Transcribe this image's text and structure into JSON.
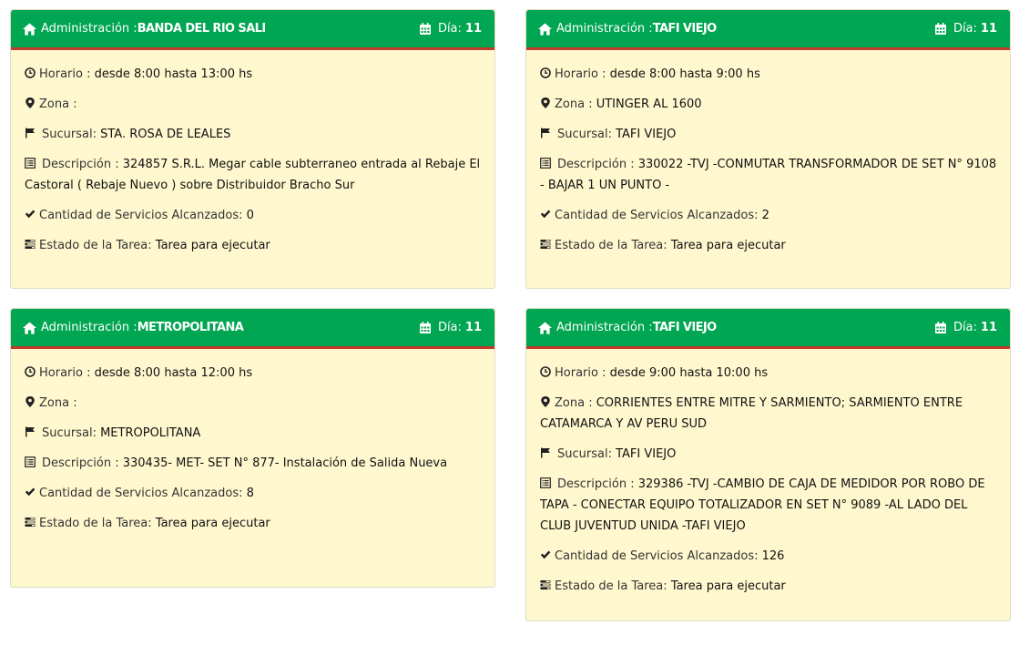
{
  "cards": [
    {
      "admin_label": "Administración :",
      "admin_value": "BANDA DEL RIO SALI",
      "dia_label": "Día:",
      "dia_value": "11",
      "horario_label": "Horario : ",
      "horario_value": "desde 8:00 hasta 13:00 hs",
      "zona_label": "Zona : ",
      "zona_value": "",
      "sucursal_label": "Sucursal: ",
      "sucursal_value": "STA. ROSA DE LEALES",
      "descripcion_label": "Descripción : ",
      "descripcion_value": "324857 S.R.L. Megar cable subterraneo entrada al Rebaje El Castoral ( Rebaje Nuevo ) sobre Distribuidor Bracho Sur",
      "cantidad_label": "Cantidad de Servicios Alcanzados: ",
      "cantidad_value": "0",
      "estado_label": "Estado de la Tarea: ",
      "estado_value": "Tarea para ejecutar"
    },
    {
      "admin_label": "Administración :",
      "admin_value": "TAFI VIEJO",
      "dia_label": "Día:",
      "dia_value": "11",
      "horario_label": "Horario : ",
      "horario_value": "desde 8:00 hasta 9:00 hs",
      "zona_label": "Zona : ",
      "zona_value": "UTINGER AL 1600",
      "sucursal_label": "Sucursal: ",
      "sucursal_value": "TAFI VIEJO",
      "descripcion_label": "Descripción : ",
      "descripcion_value": "330022 -TVJ -CONMUTAR TRANSFORMADOR DE SET N° 9108 - BAJAR 1 UN PUNTO -",
      "cantidad_label": "Cantidad de Servicios Alcanzados: ",
      "cantidad_value": "2",
      "estado_label": "Estado de la Tarea: ",
      "estado_value": "Tarea para ejecutar"
    },
    {
      "admin_label": "Administración :",
      "admin_value": "METROPOLITANA",
      "dia_label": "Día:",
      "dia_value": "11",
      "horario_label": "Horario : ",
      "horario_value": "desde 8:00 hasta 12:00 hs",
      "zona_label": "Zona : ",
      "zona_value": "",
      "sucursal_label": "Sucursal: ",
      "sucursal_value": "METROPOLITANA",
      "descripcion_label": "Descripción : ",
      "descripcion_value": "330435- MET- SET N° 877- Instalación de Salida Nueva",
      "cantidad_label": "Cantidad de Servicios Alcanzados: ",
      "cantidad_value": "8",
      "estado_label": "Estado de la Tarea: ",
      "estado_value": "Tarea para ejecutar"
    },
    {
      "admin_label": "Administración :",
      "admin_value": "TAFI VIEJO",
      "dia_label": "Día:",
      "dia_value": "11",
      "horario_label": "Horario : ",
      "horario_value": "desde 9:00 hasta 10:00 hs",
      "zona_label": "Zona : ",
      "zona_value": "CORRIENTES ENTRE MITRE Y SARMIENTO; SARMIENTO ENTRE CATAMARCA Y AV PERU SUD",
      "sucursal_label": "Sucursal: ",
      "sucursal_value": "TAFI VIEJO",
      "descripcion_label": "Descripción : ",
      "descripcion_value": "329386 -TVJ -CAMBIO DE CAJA DE MEDIDOR POR ROBO DE TAPA - CONECTAR EQUIPO TOTALIZADOR EN SET N° 9089 -AL LADO DEL CLUB JUVENTUD UNIDA -TAFI VIEJO",
      "cantidad_label": "Cantidad de Servicios Alcanzados: ",
      "cantidad_value": "126",
      "estado_label": "Estado de la Tarea: ",
      "estado_value": "Tarea para ejecutar"
    }
  ],
  "colors": {
    "header_green": "#00a651",
    "header_border_red": "#c0392b",
    "card_background": "#fff8cf"
  },
  "icons": {
    "header_left": "home-icon",
    "header_right": "calendar-icon",
    "horario": "clock-icon",
    "zona": "map-marker-icon",
    "sucursal": "flag-icon",
    "descripcion": "list-icon",
    "cantidad": "check-icon",
    "estado": "tasks-icon"
  }
}
